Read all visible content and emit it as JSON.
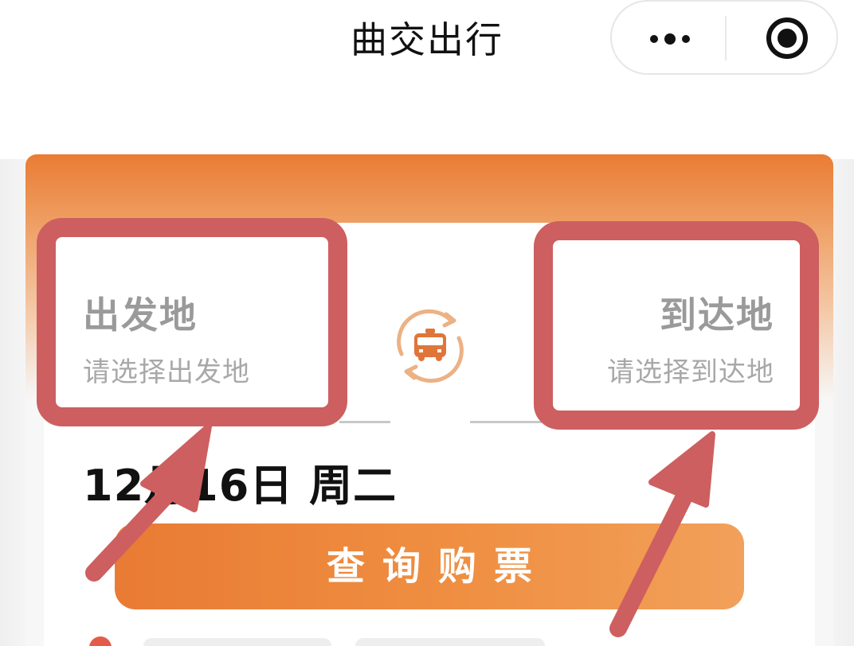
{
  "nav": {
    "title": "曲交出行",
    "more_icon": "more-dots-icon",
    "close_icon": "target-close-icon"
  },
  "booking": {
    "departure": {
      "label": "出发地",
      "hint": "请选择出发地"
    },
    "arrival": {
      "label": "到达地",
      "hint": "请选择到达地"
    },
    "swap_icon": "bus-swap-icon",
    "date": "12月16日 周二",
    "query_button": "查询购票"
  },
  "colors": {
    "accent": "#e97c34",
    "accent_light": "#f2a05a",
    "annotation": "#cd5f60",
    "label_gray": "#9a9a9a",
    "text_dark": "#111111"
  }
}
